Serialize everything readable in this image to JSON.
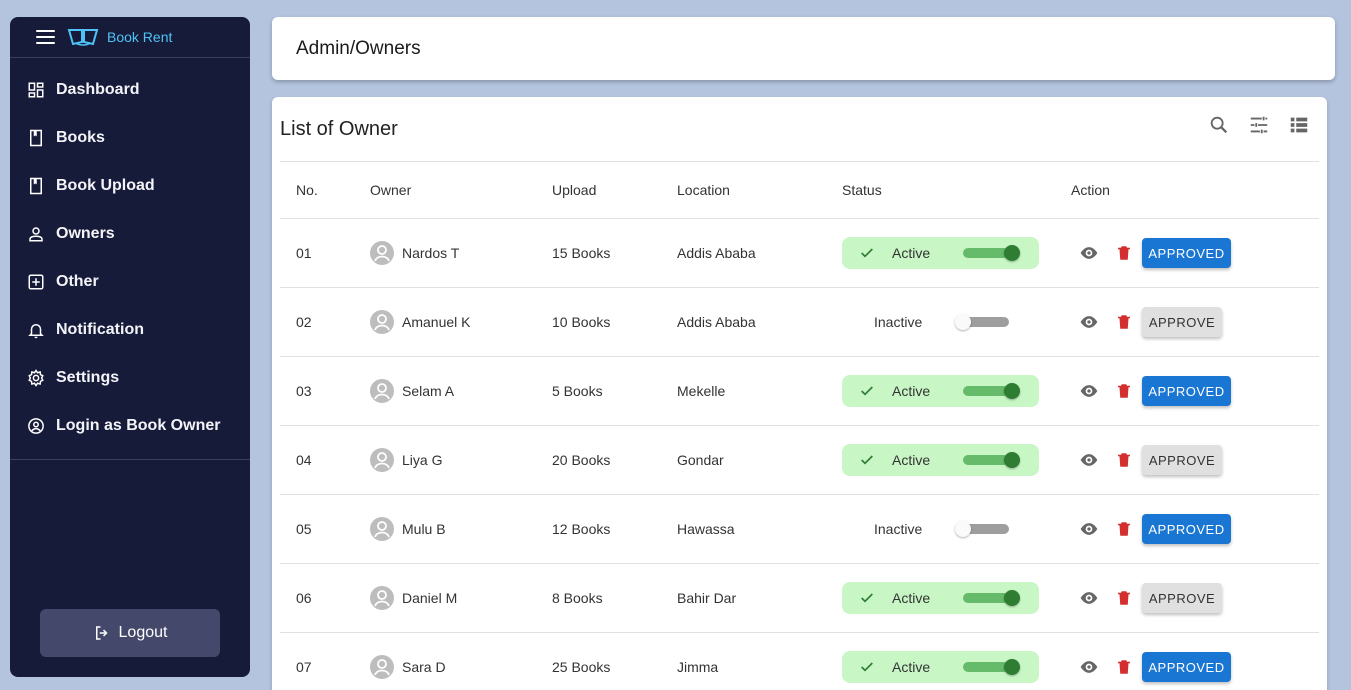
{
  "brand": {
    "name": "Book Rent"
  },
  "sidebar": {
    "items": [
      {
        "label": "Dashboard",
        "icon": "dashboard-icon"
      },
      {
        "label": "Books",
        "icon": "book-icon"
      },
      {
        "label": "Book Upload",
        "icon": "book-upload-icon"
      },
      {
        "label": "Owners",
        "icon": "person-icon"
      },
      {
        "label": "Other",
        "icon": "add-box-icon"
      },
      {
        "label": "Notification",
        "icon": "bell-icon"
      },
      {
        "label": "Settings",
        "icon": "gear-icon"
      },
      {
        "label": "Login as Book Owner",
        "icon": "account-circle-icon"
      }
    ],
    "logout_label": "Logout"
  },
  "header": {
    "breadcrumb": "Admin/Owners"
  },
  "main": {
    "title": "List of Owner",
    "columns": [
      "No.",
      "Owner",
      "Upload",
      "Location",
      "Status",
      "Action"
    ],
    "rows": [
      {
        "no": "01",
        "owner": "Nardos T",
        "upload": "15 Books",
        "location": "Addis Ababa",
        "status": "Active",
        "action": "APPROVED"
      },
      {
        "no": "02",
        "owner": "Amanuel K",
        "upload": "10 Books",
        "location": "Addis Ababa",
        "status": "Inactive",
        "action": "APPROVE"
      },
      {
        "no": "03",
        "owner": "Selam A",
        "upload": "5 Books",
        "location": "Mekelle",
        "status": "Active",
        "action": "APPROVED"
      },
      {
        "no": "04",
        "owner": "Liya G",
        "upload": "20 Books",
        "location": "Gondar",
        "status": "Active",
        "action": "APPROVE"
      },
      {
        "no": "05",
        "owner": "Mulu B",
        "upload": "12 Books",
        "location": "Hawassa",
        "status": "Inactive",
        "action": "APPROVED"
      },
      {
        "no": "06",
        "owner": "Daniel M",
        "upload": "8 Books",
        "location": "Bahir Dar",
        "status": "Active",
        "action": "APPROVE"
      },
      {
        "no": "07",
        "owner": "Sara D",
        "upload": "25 Books",
        "location": "Jimma",
        "status": "Active",
        "action": "APPROVED"
      }
    ]
  },
  "colors": {
    "sidebar_bg": "#171b3a",
    "brand_accent": "#4fc3f7",
    "approved_blue": "#1976d2",
    "active_green_bg": "#c8f7c5",
    "switch_green": "#2e7d32",
    "delete_red": "#d32f2f",
    "page_bg": "#b4c4de"
  }
}
